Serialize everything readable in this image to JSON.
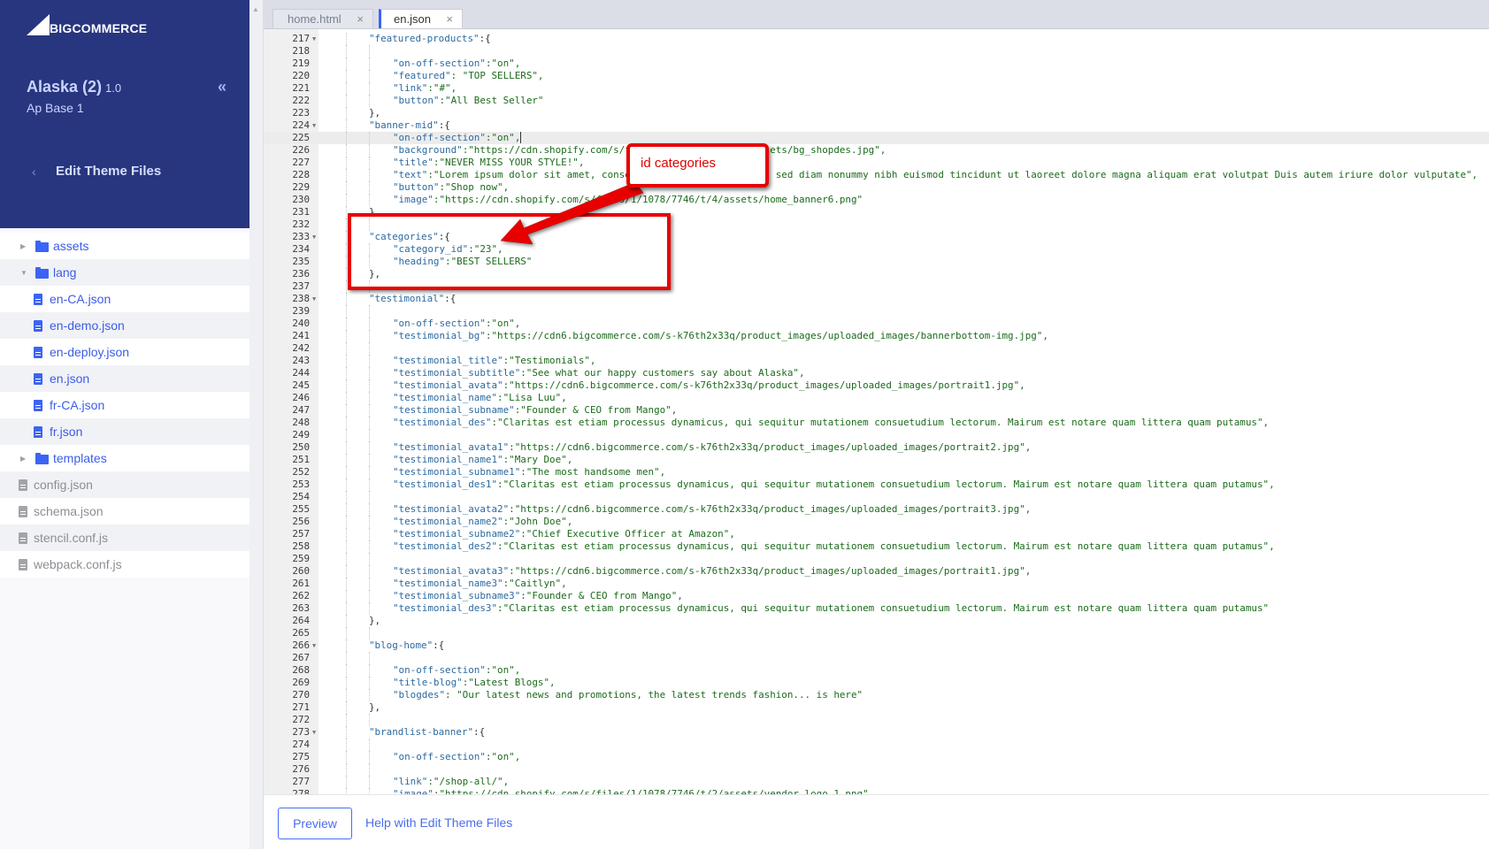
{
  "sidebar": {
    "brand": "BIGCOMMERCE",
    "store_name": "Alaska (2)",
    "store_version": "1.0",
    "store_subtitle": "Ap Base 1",
    "collapse_icon": "«",
    "back_icon": "‹",
    "section_title": "Edit Theme Files",
    "tree": [
      {
        "label": "assets",
        "type": "folder",
        "state": "collapsed"
      },
      {
        "label": "lang",
        "type": "folder",
        "state": "expanded"
      },
      {
        "label": "en-CA.json",
        "type": "file"
      },
      {
        "label": "en-demo.json",
        "type": "file"
      },
      {
        "label": "en-deploy.json",
        "type": "file"
      },
      {
        "label": "en.json",
        "type": "file"
      },
      {
        "label": "fr-CA.json",
        "type": "file"
      },
      {
        "label": "fr.json",
        "type": "file"
      },
      {
        "label": "templates",
        "type": "folder",
        "state": "collapsed"
      },
      {
        "label": "config.json",
        "type": "file-root"
      },
      {
        "label": "schema.json",
        "type": "file-root"
      },
      {
        "label": "stencil.conf.js",
        "type": "file-root"
      },
      {
        "label": "webpack.conf.js",
        "type": "file-root"
      }
    ]
  },
  "tabs": [
    {
      "label": "home.html",
      "active": false,
      "close": "×"
    },
    {
      "label": "en.json",
      "active": true,
      "close": "×"
    }
  ],
  "editor": {
    "active_line": 225,
    "lines": [
      {
        "n": "217",
        "fold": true,
        "indent": 1,
        "key": "\"featured-products\"",
        "rest": ":{"
      },
      {
        "n": "218",
        "indent": 0
      },
      {
        "n": "219",
        "indent": 2,
        "key": "\"on-off-section\"",
        "val": ":\"on\","
      },
      {
        "n": "220",
        "indent": 2,
        "key": "\"featured\"",
        "val": ": \"TOP SELLERS\","
      },
      {
        "n": "221",
        "indent": 2,
        "key": "\"link\"",
        "val": ":\"#\","
      },
      {
        "n": "222",
        "indent": 2,
        "key": "\"button\"",
        "val": ":\"All Best Seller\""
      },
      {
        "n": "223",
        "indent": 1,
        "rest": "},"
      },
      {
        "n": "224",
        "fold": true,
        "indent": 1,
        "key": "\"banner-mid\"",
        "rest": ":{"
      },
      {
        "n": "225",
        "indent": 2,
        "key": "\"on-off-section\"",
        "val": ":\"on\",",
        "cursor": true
      },
      {
        "n": "226",
        "indent": 2,
        "key": "\"background\"",
        "val": ":\"https://cdn.shopify.com/s/files/1/1078/7746/t/4/assets/bg_shopdes.jpg\","
      },
      {
        "n": "227",
        "indent": 2,
        "key": "\"title\"",
        "val": ":\"NEVER MISS YOUR STYLE!\","
      },
      {
        "n": "228",
        "indent": 2,
        "key": "\"text\"",
        "val": ":\"Lorem ipsum dolor sit amet, consectetuer adipiscing elit, sed diam nonummy nibh euismod tincidunt ut laoreet dolore magna aliquam erat volutpat Duis autem iriure dolor vulputate\","
      },
      {
        "n": "229",
        "indent": 2,
        "key": "\"button\"",
        "val": ":\"Shop now\","
      },
      {
        "n": "230",
        "indent": 2,
        "key": "\"image\"",
        "val": ":\"https://cdn.shopify.com/s/files/1/1078/7746/t/4/assets/home_banner6.png\""
      },
      {
        "n": "231",
        "indent": 1,
        "rest": "},"
      },
      {
        "n": "232",
        "indent": 0
      },
      {
        "n": "233",
        "fold": true,
        "indent": 1,
        "key": "\"categories\"",
        "rest": ":{"
      },
      {
        "n": "234",
        "indent": 2,
        "key": "\"category_id\"",
        "val": ":\"23\","
      },
      {
        "n": "235",
        "indent": 2,
        "key": "\"heading\"",
        "val": ":\"BEST SELLERS\""
      },
      {
        "n": "236",
        "indent": 1,
        "rest": "},"
      },
      {
        "n": "237",
        "indent": 0
      },
      {
        "n": "238",
        "fold": true,
        "indent": 1,
        "key": "\"testimonial\"",
        "rest": ":{"
      },
      {
        "n": "239",
        "indent": 0
      },
      {
        "n": "240",
        "indent": 2,
        "key": "\"on-off-section\"",
        "val": ":\"on\","
      },
      {
        "n": "241",
        "indent": 2,
        "key": "\"testimonial_bg\"",
        "val": ":\"https://cdn6.bigcommerce.com/s-k76th2x33q/product_images/uploaded_images/bannerbottom-img.jpg\","
      },
      {
        "n": "242",
        "indent": 0
      },
      {
        "n": "243",
        "indent": 2,
        "key": "\"testimonial_title\"",
        "val": ":\"Testimonials\","
      },
      {
        "n": "244",
        "indent": 2,
        "key": "\"testimonial_subtitle\"",
        "val": ":\"See what our happy customers say about Alaska\","
      },
      {
        "n": "245",
        "indent": 2,
        "key": "\"testimonial_avata\"",
        "val": ":\"https://cdn6.bigcommerce.com/s-k76th2x33q/product_images/uploaded_images/portrait1.jpg\","
      },
      {
        "n": "246",
        "indent": 2,
        "key": "\"testimonial_name\"",
        "val": ":\"Lisa Luu\","
      },
      {
        "n": "247",
        "indent": 2,
        "key": "\"testimonial_subname\"",
        "val": ":\"Founder & CEO from Mango\","
      },
      {
        "n": "248",
        "indent": 2,
        "key": "\"testimonial_des\"",
        "val": ":\"Claritas est etiam processus dynamicus, qui sequitur mutationem consuetudium lectorum. Mairum est notare quam littera quam putamus\","
      },
      {
        "n": "249",
        "indent": 0
      },
      {
        "n": "250",
        "indent": 2,
        "key": "\"testimonial_avata1\"",
        "val": ":\"https://cdn6.bigcommerce.com/s-k76th2x33q/product_images/uploaded_images/portrait2.jpg\","
      },
      {
        "n": "251",
        "indent": 2,
        "key": "\"testimonial_name1\"",
        "val": ":\"Mary Doe\","
      },
      {
        "n": "252",
        "indent": 2,
        "key": "\"testimonial_subname1\"",
        "val": ":\"The most handsome men\","
      },
      {
        "n": "253",
        "indent": 2,
        "key": "\"testimonial_des1\"",
        "val": ":\"Claritas est etiam processus dynamicus, qui sequitur mutationem consuetudium lectorum. Mairum est notare quam littera quam putamus\","
      },
      {
        "n": "254",
        "indent": 0
      },
      {
        "n": "255",
        "indent": 2,
        "key": "\"testimonial_avata2\"",
        "val": ":\"https://cdn6.bigcommerce.com/s-k76th2x33q/product_images/uploaded_images/portrait3.jpg\","
      },
      {
        "n": "256",
        "indent": 2,
        "key": "\"testimonial_name2\"",
        "val": ":\"John Doe\","
      },
      {
        "n": "257",
        "indent": 2,
        "key": "\"testimonial_subname2\"",
        "val": ":\"Chief Executive Officer at Amazon\","
      },
      {
        "n": "258",
        "indent": 2,
        "key": "\"testimonial_des2\"",
        "val": ":\"Claritas est etiam processus dynamicus, qui sequitur mutationem consuetudium lectorum. Mairum est notare quam littera quam putamus\","
      },
      {
        "n": "259",
        "indent": 0
      },
      {
        "n": "260",
        "indent": 2,
        "key": "\"testimonial_avata3\"",
        "val": ":\"https://cdn6.bigcommerce.com/s-k76th2x33q/product_images/uploaded_images/portrait1.jpg\","
      },
      {
        "n": "261",
        "indent": 2,
        "key": "\"testimonial_name3\"",
        "val": ":\"Caitlyn\","
      },
      {
        "n": "262",
        "indent": 2,
        "key": "\"testimonial_subname3\"",
        "val": ":\"Founder & CEO from Mango\","
      },
      {
        "n": "263",
        "indent": 2,
        "key": "\"testimonial_des3\"",
        "val": ":\"Claritas est etiam processus dynamicus, qui sequitur mutationem consuetudium lectorum. Mairum est notare quam littera quam putamus\""
      },
      {
        "n": "264",
        "indent": 1,
        "rest": "},"
      },
      {
        "n": "265",
        "indent": 0
      },
      {
        "n": "266",
        "fold": true,
        "indent": 1,
        "key": "\"blog-home\"",
        "rest": ":{"
      },
      {
        "n": "267",
        "indent": 0
      },
      {
        "n": "268",
        "indent": 2,
        "key": "\"on-off-section\"",
        "val": ":\"on\","
      },
      {
        "n": "269",
        "indent": 2,
        "key": "\"title-blog\"",
        "val": ":\"Latest Blogs\","
      },
      {
        "n": "270",
        "indent": 2,
        "key": "\"blogdes\"",
        "val": ": \"Our latest news and promotions, the latest trends fashion... is here\""
      },
      {
        "n": "271",
        "indent": 1,
        "rest": "},"
      },
      {
        "n": "272",
        "indent": 0
      },
      {
        "n": "273",
        "fold": true,
        "indent": 1,
        "key": "\"brandlist-banner\"",
        "rest": ":{"
      },
      {
        "n": "274",
        "indent": 0
      },
      {
        "n": "275",
        "indent": 2,
        "key": "\"on-off-section\"",
        "val": ":\"on\","
      },
      {
        "n": "276",
        "indent": 0
      },
      {
        "n": "277",
        "indent": 2,
        "key": "\"link\"",
        "val": ":\"/shop-all/\","
      },
      {
        "n": "278",
        "indent": 2,
        "key": "\"image\"",
        "val": ":\"https://cdn.shopify.com/s/files/1/1078/7746/t/2/assets/vendor_logo_1.png\","
      }
    ]
  },
  "footer": {
    "preview_label": "Preview",
    "help_label": "Help with Edit Theme Files"
  },
  "annotation": {
    "callout_text": "id categories",
    "color": "#e80000"
  },
  "colors": {
    "sidebar_header": "#28367f",
    "accent": "#3c64f4",
    "json_key": "#2d6aa0",
    "json_value": "#1c6b1c"
  }
}
